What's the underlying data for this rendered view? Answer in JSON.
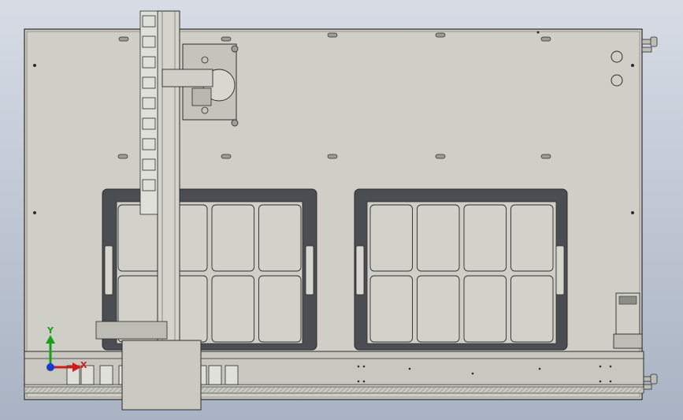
{
  "view": {
    "background_top": "#d7dce5",
    "background_bottom": "#a9b3c3",
    "part_fill": "#cfcfc8",
    "line_color": "#2c2c2c",
    "tray_dark": "#4a4d52"
  },
  "axis_triad": {
    "x_label": "X",
    "y_label": "Y",
    "x_color": "#d11a1a",
    "y_color": "#18a018",
    "z_color": "#1a3ad1"
  },
  "trays": [
    {
      "name": "left-tray",
      "rows": 2,
      "columns": 4
    },
    {
      "name": "right-tray",
      "rows": 2,
      "columns": 4
    }
  ]
}
